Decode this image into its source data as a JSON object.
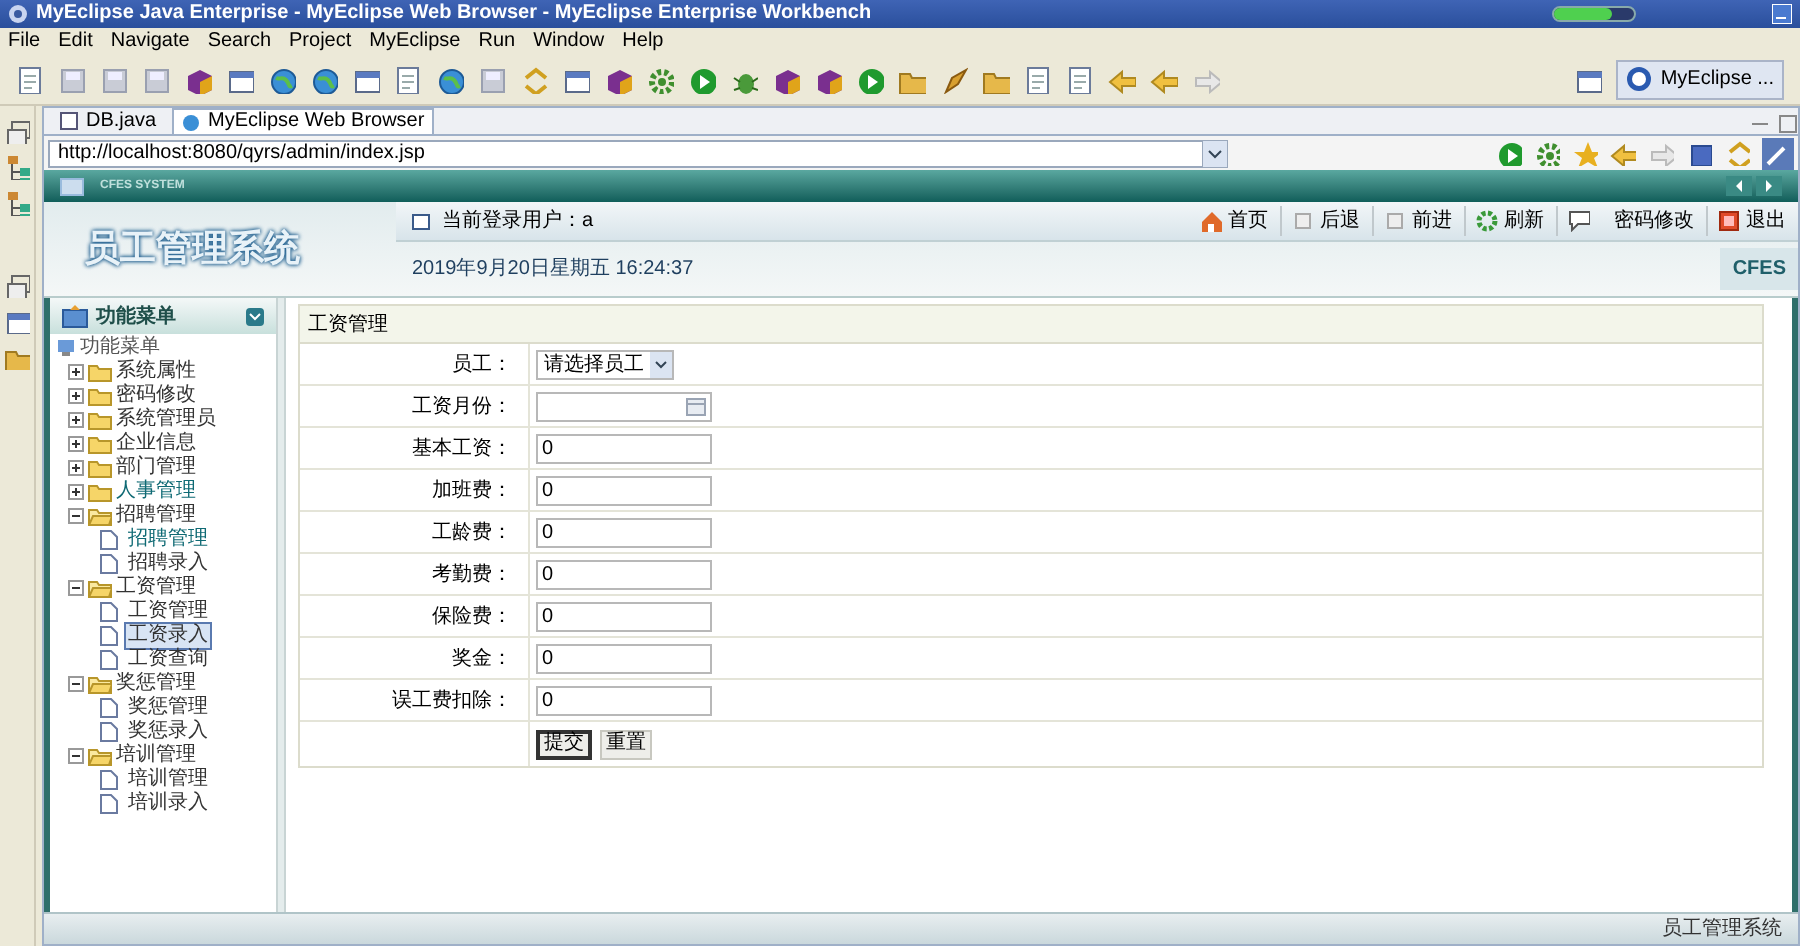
{
  "window": {
    "title": "MyEclipse Java Enterprise - MyEclipse Web Browser - MyEclipse Enterprise Workbench"
  },
  "menu": [
    "File",
    "Edit",
    "Navigate",
    "Search",
    "Project",
    "MyEclipse",
    "Run",
    "Window",
    "Help"
  ],
  "perspective": {
    "label": "MyEclipse ..."
  },
  "editor_tabs": [
    {
      "label": "DB.java",
      "selected": false
    },
    {
      "label": "MyEclipse Web Browser",
      "selected": true
    }
  ],
  "address": {
    "value": "http://localhost:8080/qyrs/admin/index.jsp"
  },
  "page": {
    "banner": "CFES SYSTEM",
    "logo": "员工管理系统",
    "user": "当前登录用户：a",
    "nav": [
      {
        "label": "首页",
        "kind": "home"
      },
      {
        "label": "后退",
        "kind": "back"
      },
      {
        "label": "前进",
        "kind": "forward"
      },
      {
        "label": "刷新",
        "kind": "refresh"
      },
      {
        "label": "密码修改",
        "kind": "password"
      },
      {
        "label": "退出",
        "kind": "exit"
      }
    ],
    "datetime": "2019年9月20日星期五  16:24:37",
    "badge": "CFES",
    "sidebar": {
      "title": "功能菜单",
      "root": "功能菜单",
      "tree": [
        {
          "label": "系统属性",
          "expanded": false,
          "visited": false
        },
        {
          "label": "密码修改",
          "expanded": false,
          "visited": false
        },
        {
          "label": "系统管理员",
          "expanded": false,
          "visited": false
        },
        {
          "label": "企业信息",
          "expanded": false,
          "visited": false
        },
        {
          "label": "部门管理",
          "expanded": false,
          "visited": false
        },
        {
          "label": "人事管理",
          "expanded": false,
          "visited": true
        },
        {
          "label": "招聘管理",
          "expanded": true,
          "visited": false,
          "children": [
            {
              "label": "招聘管理",
              "selected": false,
              "visited": true
            },
            {
              "label": "招聘录入",
              "selected": false,
              "visited": false
            }
          ]
        },
        {
          "label": "工资管理",
          "expanded": true,
          "visited": false,
          "children": [
            {
              "label": "工资管理",
              "selected": false,
              "visited": false
            },
            {
              "label": "工资录入",
              "selected": true,
              "visited": false
            },
            {
              "label": "工资查询",
              "selected": false,
              "visited": false
            }
          ]
        },
        {
          "label": "奖惩管理",
          "expanded": true,
          "visited": false,
          "children": [
            {
              "label": "奖惩管理",
              "selected": false,
              "visited": false
            },
            {
              "label": "奖惩录入",
              "selected": false,
              "visited": false
            }
          ]
        },
        {
          "label": "培训管理",
          "expanded": true,
          "visited": false,
          "children": [
            {
              "label": "培训管理",
              "selected": false,
              "visited": false
            },
            {
              "label": "培训录入",
              "selected": false,
              "visited": false
            }
          ]
        }
      ]
    },
    "form": {
      "title": "工资管理",
      "fields": [
        {
          "label": "员工：",
          "kind": "select",
          "value": "请选择员工"
        },
        {
          "label": "工资月份：",
          "kind": "date"
        },
        {
          "label": "基本工资：",
          "kind": "text",
          "value": "0"
        },
        {
          "label": "加班费：",
          "kind": "text",
          "value": "0"
        },
        {
          "label": "工龄费：",
          "kind": "text",
          "value": "0"
        },
        {
          "label": "考勤费：",
          "kind": "text",
          "value": "0"
        },
        {
          "label": "保险费：",
          "kind": "text",
          "value": "0"
        },
        {
          "label": "奖金：",
          "kind": "text",
          "value": "0"
        },
        {
          "label": "误工费扣除：",
          "kind": "text",
          "value": "0"
        }
      ],
      "buttons": [
        {
          "label": "提交",
          "focused": true
        },
        {
          "label": "重置",
          "focused": false
        }
      ]
    },
    "footer": "员工管理系统"
  }
}
